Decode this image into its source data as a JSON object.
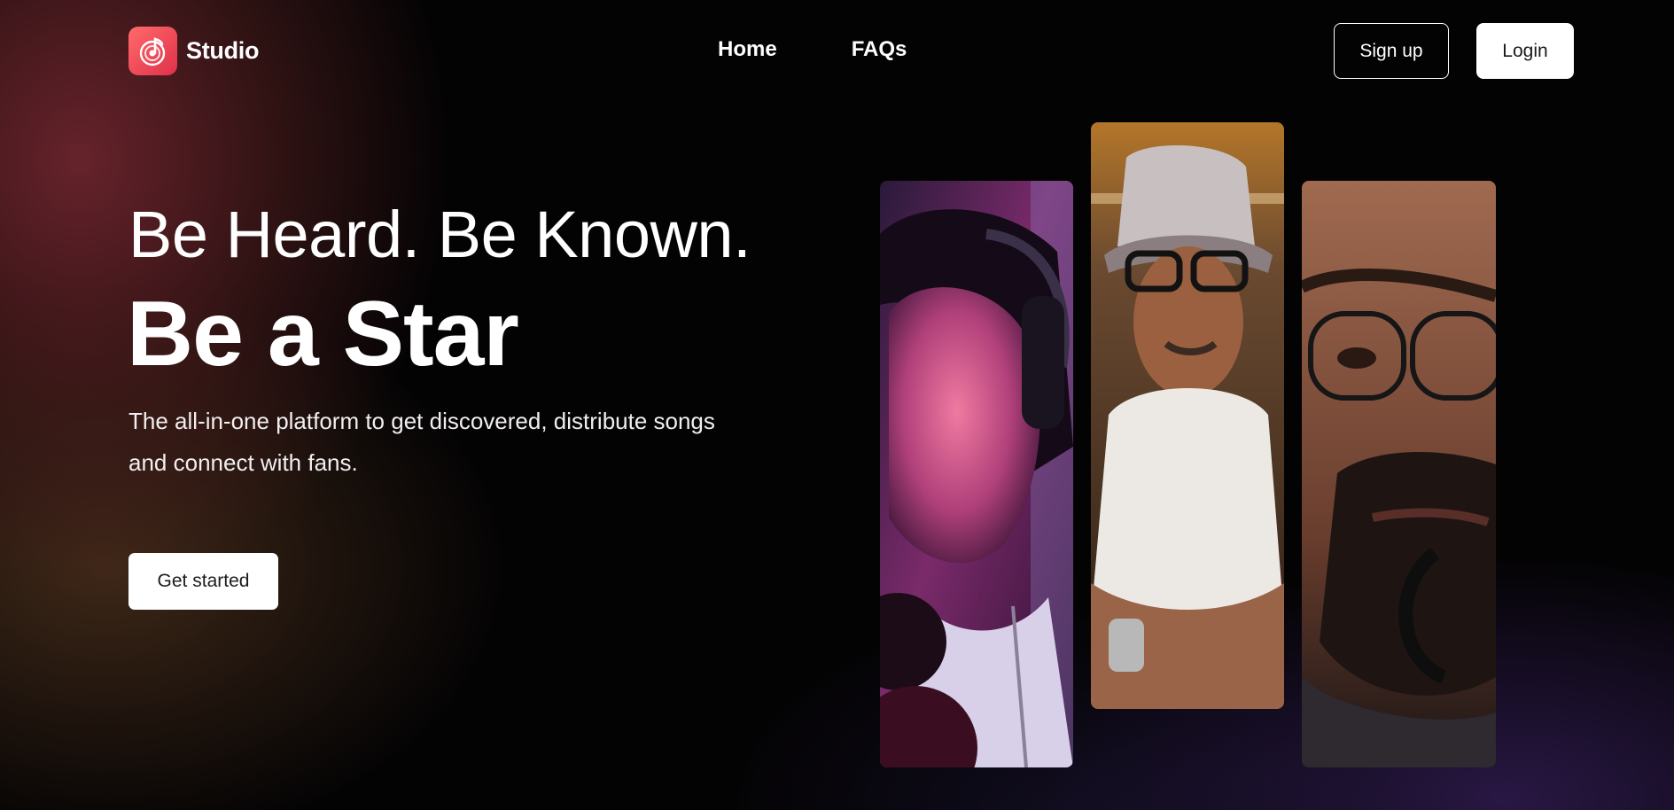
{
  "brand": {
    "name": "Studio",
    "icon": "music-note-icon",
    "color": "#f04a5a"
  },
  "nav": {
    "items": [
      {
        "label": "Home"
      },
      {
        "label": "FAQs"
      }
    ]
  },
  "auth": {
    "signup_label": "Sign up",
    "login_label": "Login"
  },
  "hero": {
    "line1": "Be Heard. Be Known.",
    "line2": "Be a Star",
    "subtitle": "The all-in-one platform to get discovered, distribute songs and connect with fans.",
    "cta_label": "Get started"
  },
  "colors": {
    "accent": "#f04a5a",
    "background": "#050305"
  }
}
